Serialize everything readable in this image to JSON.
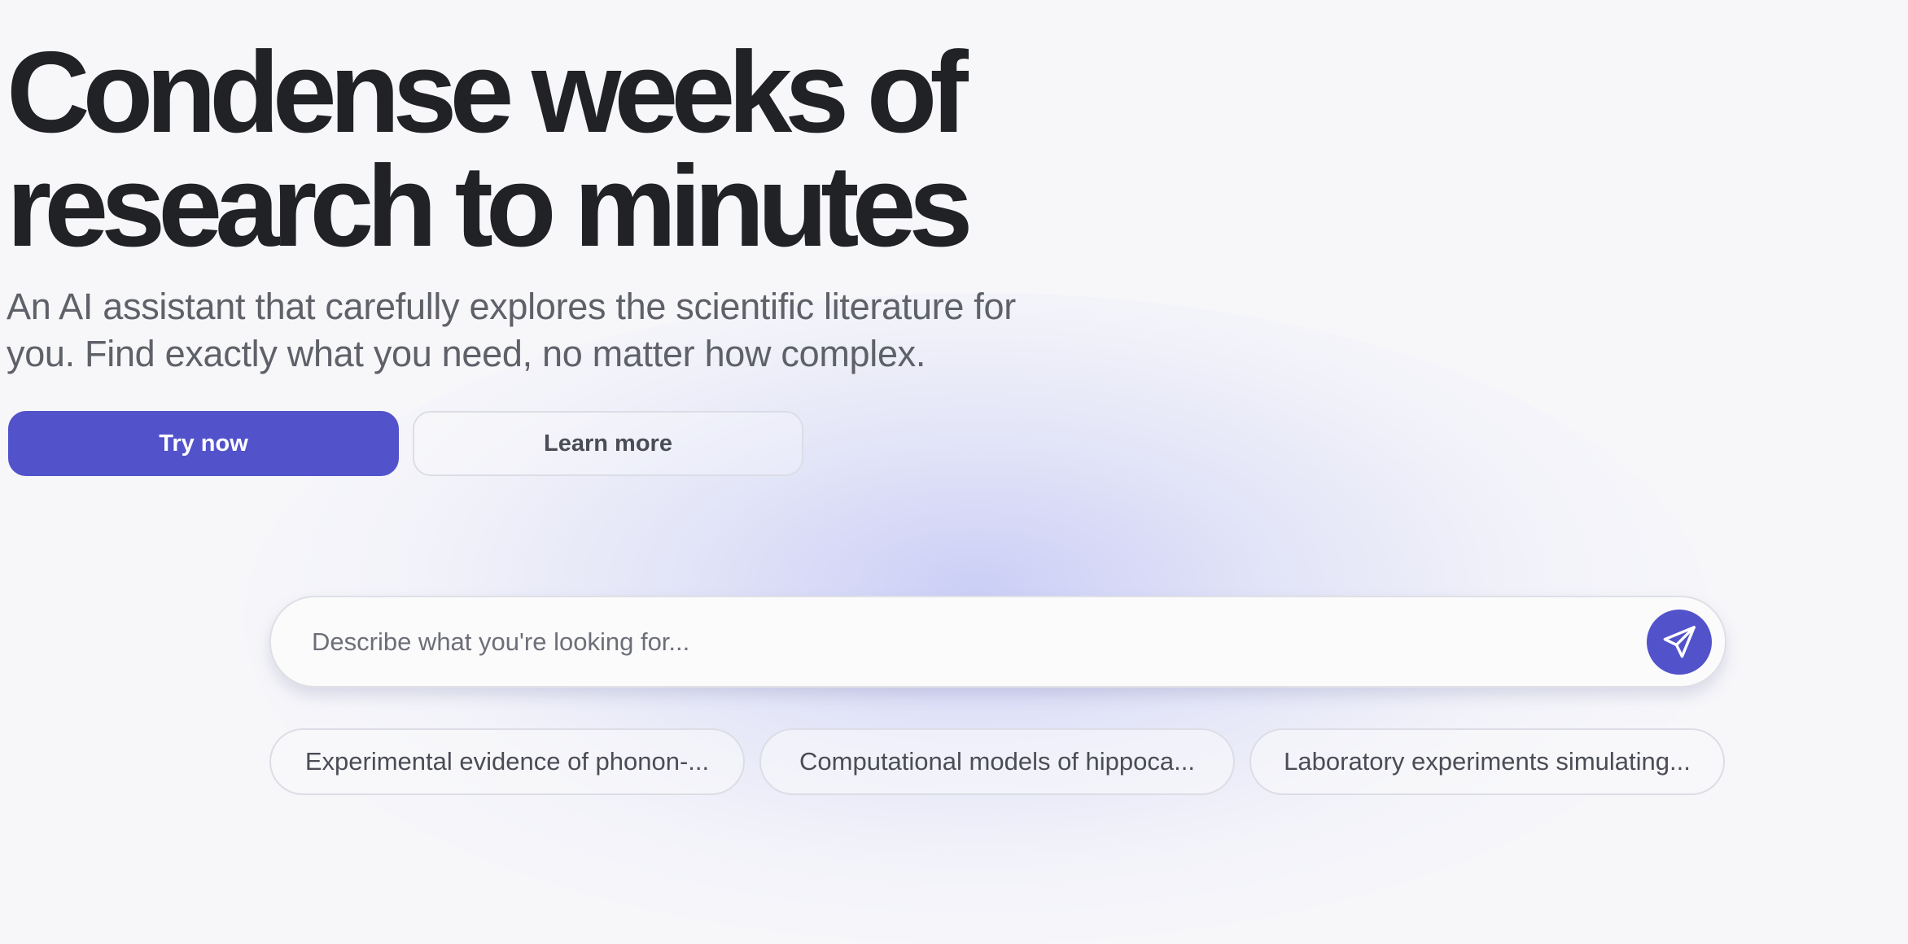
{
  "hero": {
    "headline_line1": "Condense weeks of",
    "headline_line2": "research to minutes",
    "subhead_line1": "An AI assistant that carefully explores the scientific literature for",
    "subhead_line2": "you. Find exactly what you need, no matter how complex."
  },
  "actions": {
    "primary_label": "Try now",
    "secondary_label": "Learn more"
  },
  "search": {
    "value": "",
    "placeholder": "Describe what you're looking for...",
    "send_icon": "paper-plane-icon"
  },
  "suggestions": [
    {
      "label": "Experimental evidence of phonon-..."
    },
    {
      "label": "Computational models of hippoca..."
    },
    {
      "label": "Laboratory experiments simulating..."
    }
  ],
  "colors": {
    "accent": "#5252cb",
    "headline": "#212226",
    "subhead": "#5f6169",
    "background": "#f7f7fa"
  }
}
